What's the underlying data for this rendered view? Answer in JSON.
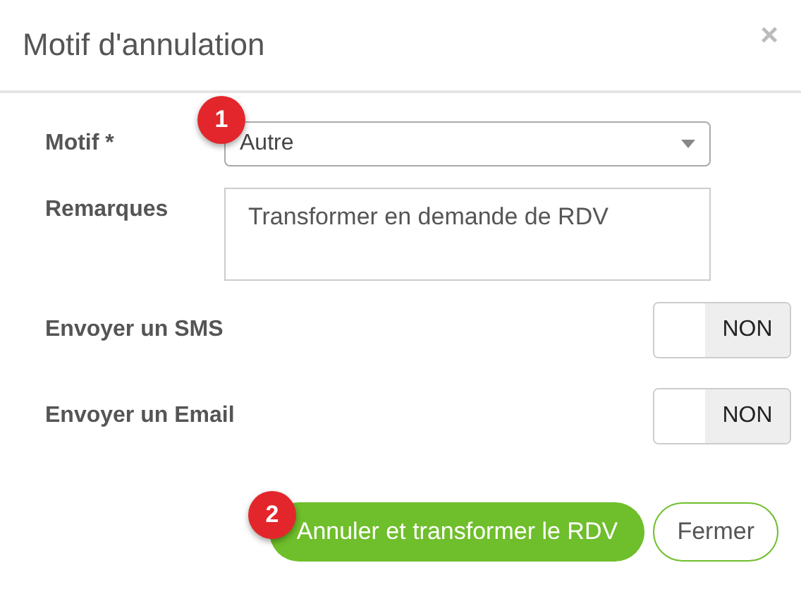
{
  "dialog": {
    "title": "Motif d'annulation",
    "close": "×"
  },
  "fields": [
    {
      "kind": "select",
      "label": "Motif *",
      "value": "Autre"
    },
    {
      "kind": "textarea",
      "label": "Remarques",
      "value": "Transformer en demande de RDV"
    },
    {
      "kind": "toggle",
      "label": "Envoyer un SMS",
      "on": false,
      "state_text": "NON"
    },
    {
      "kind": "toggle",
      "label": "Envoyer un Email",
      "on": false,
      "state_text": "NON"
    }
  ],
  "buttons": [
    {
      "kind": "primary",
      "label": "Annuler et transformer le RDV"
    },
    {
      "kind": "secondary",
      "label": "Fermer"
    }
  ],
  "step_badges": [
    "1",
    "2"
  ]
}
